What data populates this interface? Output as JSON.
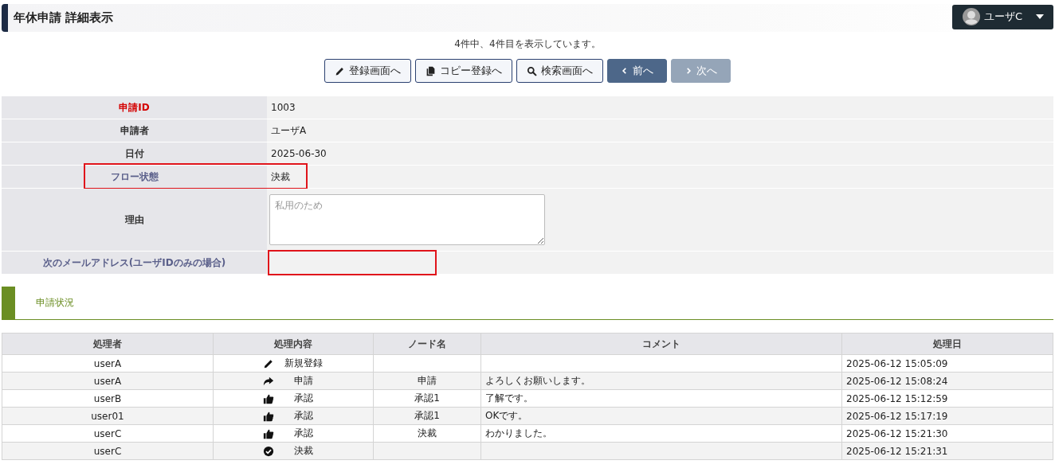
{
  "header": {
    "title": "年休申請 詳細表示",
    "user": "ユーザC"
  },
  "record_info": "4件中、4件目を表示しています。",
  "buttons": [
    {
      "label": "登録画面へ",
      "disabled": false
    },
    {
      "label": "コピー登録へ",
      "disabled": false
    },
    {
      "label": "検索画面へ",
      "disabled": false
    },
    {
      "label": "前へ",
      "disabled": false
    },
    {
      "label": "次へ",
      "disabled": true
    }
  ],
  "fields": [
    {
      "label": "申請ID",
      "color": "#d40000",
      "kind": "text",
      "value": "1003"
    },
    {
      "label": "申請者",
      "color": "#333333",
      "kind": "text",
      "value": "ユーザA"
    },
    {
      "label": "日付",
      "color": "#333333",
      "kind": "text",
      "value": "2025-06-30"
    },
    {
      "label": "フロー状態",
      "color": "#5a5f8a",
      "kind": "text",
      "value": "決裁",
      "highlighted": true
    },
    {
      "label": "理由",
      "color": "#333333",
      "kind": "textarea",
      "placeholder": "私用のため"
    },
    {
      "label": "次のメールアドレス(ユーザIDのみの場合)",
      "color": "#5a5f8a",
      "kind": "text",
      "highlighted": true
    }
  ],
  "section": {
    "title": "申請状況"
  },
  "history": {
    "columns": [
      "処理者",
      "処理内容",
      "ノード名",
      "コメント",
      "処理日"
    ],
    "rows": [
      {
        "user": "userA",
        "kind": "create",
        "action": "新規登録",
        "date": "2025-06-12 15:05:09"
      },
      {
        "user": "userA",
        "kind": "apply",
        "action": "申請",
        "node": "申請",
        "comment": "よろしくお願いします。",
        "date": "2025-06-12 15:08:24"
      },
      {
        "user": "userB",
        "kind": "approve",
        "action": "承認",
        "node": "承認1",
        "comment": "了解です。",
        "date": "2025-06-12 15:12:59"
      },
      {
        "user": "user01",
        "kind": "approve",
        "action": "承認",
        "node": "承認1",
        "comment": "OKです。",
        "date": "2025-06-12 15:17:19"
      },
      {
        "user": "userC",
        "kind": "approve",
        "action": "承認",
        "node": "決裁",
        "comment": "わかりました。",
        "date": "2025-06-12 15:21:30"
      },
      {
        "user": "userC",
        "kind": "decide",
        "action": "決裁",
        "date": "2025-06-12 15:21:31"
      }
    ]
  }
}
